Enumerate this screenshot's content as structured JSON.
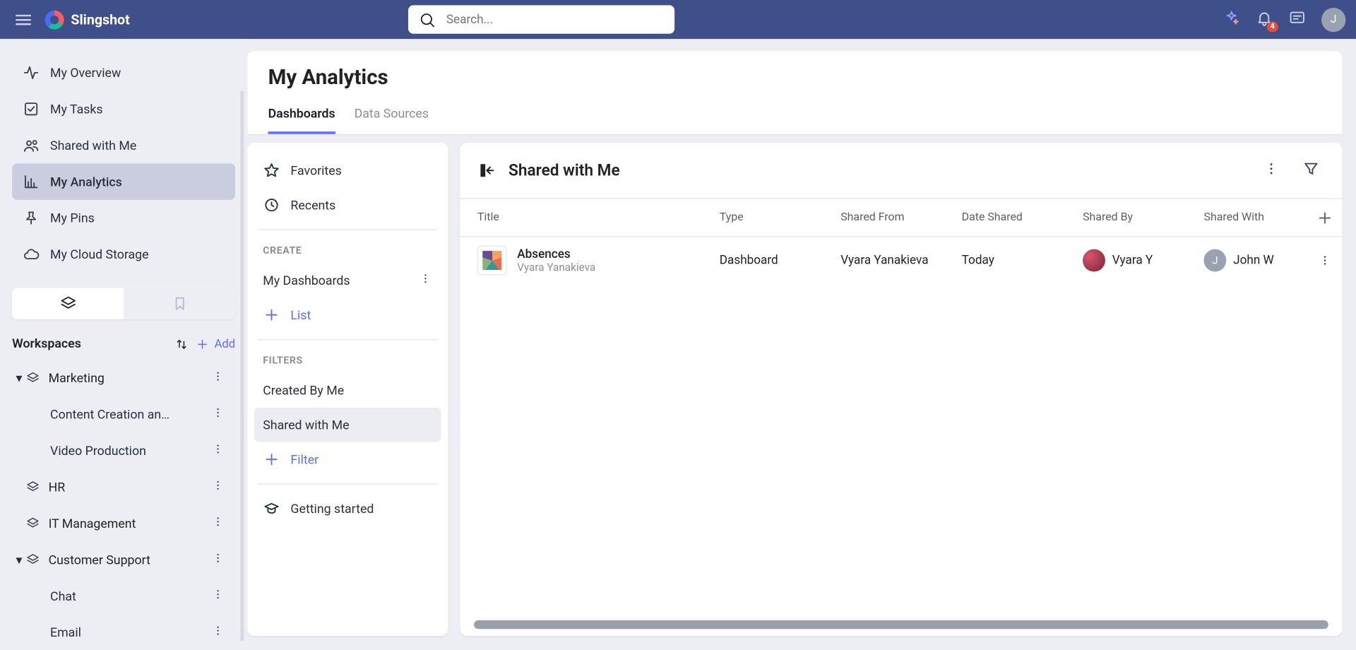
{
  "app": {
    "name": "Slingshot"
  },
  "search": {
    "placeholder": "Search..."
  },
  "notifications": {
    "count": "4"
  },
  "user": {
    "initial": "J"
  },
  "nav": {
    "items": [
      {
        "label": "My Overview"
      },
      {
        "label": "My Tasks"
      },
      {
        "label": "Shared with Me"
      },
      {
        "label": "My Analytics"
      },
      {
        "label": "My Pins"
      },
      {
        "label": "My Cloud Storage"
      }
    ]
  },
  "workspaces": {
    "title": "Workspaces",
    "add_label": "Add",
    "tree": {
      "marketing": {
        "label": "Marketing",
        "children": [
          {
            "label": "Content Creation an…"
          },
          {
            "label": "Video Production"
          }
        ]
      },
      "hr": {
        "label": "HR"
      },
      "it": {
        "label": "IT Management"
      },
      "cs": {
        "label": "Customer Support",
        "children": [
          {
            "label": "Chat"
          },
          {
            "label": "Email"
          }
        ]
      }
    }
  },
  "page": {
    "title": "My Analytics",
    "tabs": [
      {
        "label": "Dashboards",
        "active": true
      },
      {
        "label": "Data Sources",
        "active": false
      }
    ]
  },
  "left_panel": {
    "favorites": "Favorites",
    "recents": "Recents",
    "create_header": "CREATE",
    "my_dashboards": "My Dashboards",
    "add_list": "List",
    "filters_header": "FILTERS",
    "created_by_me": "Created By Me",
    "shared_with_me": "Shared with Me",
    "add_filter": "Filter",
    "getting_started": "Getting started"
  },
  "right_panel": {
    "title": "Shared with Me",
    "columns": {
      "title": "Title",
      "type": "Type",
      "shared_from": "Shared From",
      "date_shared": "Date Shared",
      "shared_by": "Shared By",
      "shared_with": "Shared With"
    },
    "rows": [
      {
        "title": "Absences",
        "subtitle": "Vyara Yanakieva",
        "type": "Dashboard",
        "shared_from": "Vyara Yanakieva",
        "date_shared": "Today",
        "shared_by": {
          "name": "Vyara Y"
        },
        "shared_with": {
          "name": "John W",
          "initial": "J"
        }
      }
    ]
  }
}
